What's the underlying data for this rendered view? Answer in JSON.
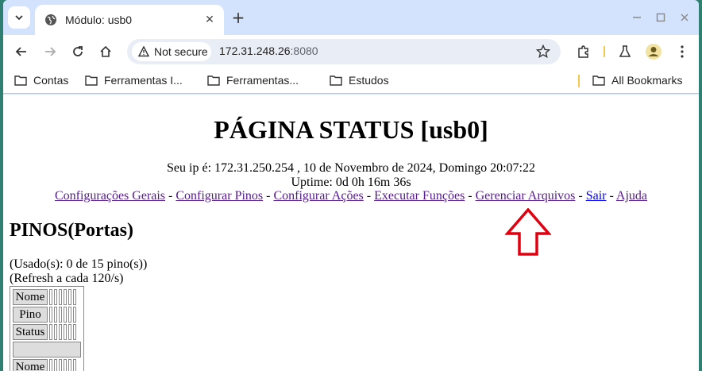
{
  "browser": {
    "tab": {
      "title": "Módulo: usb0"
    },
    "omnibox": {
      "security_label": "Not secure",
      "host": "172.31.248.26",
      "port": ":8080"
    },
    "bookmarks": [
      {
        "label": "Contas"
      },
      {
        "label": "Ferramentas I..."
      },
      {
        "label": "Ferramentas..."
      },
      {
        "label": "Estudos"
      }
    ],
    "all_bookmarks": "All Bookmarks"
  },
  "page": {
    "title": "PÁGINA STATUS [usb0]",
    "ip_line": "Seu ip é: 172.31.250.254 , 10 de Novembro de 2024, Domingo 20:07:22",
    "uptime_line": "Uptime: 0d 0h 16m 36s",
    "nav": [
      {
        "label": "Configurações Gerais"
      },
      {
        "label": "Configurar Pinos"
      },
      {
        "label": "Configurar Ações"
      },
      {
        "label": "Executar Funções"
      },
      {
        "label": "Gerenciar Arquivos"
      },
      {
        "label": "Sair"
      },
      {
        "label": "Ajuda"
      }
    ],
    "nav_separator": "-",
    "section_title": "PINOS(Portas)",
    "usage_line": "(Usado(s): 0 de 15 pino(s))",
    "refresh_line": "(Refresh a cada 120/s)",
    "table_rows": [
      "Nome",
      "Pino",
      "Status",
      "",
      "Nome"
    ]
  },
  "colors": {
    "frame": "#d3e3fd",
    "arrow": "#e0000f"
  }
}
